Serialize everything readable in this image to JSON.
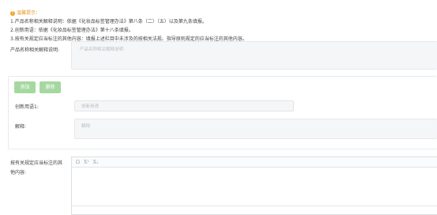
{
  "tips": {
    "title": "温馨提示：",
    "lines": [
      "1.产品名称相关解释说明：依据《化妆品标签管理办法》第八条（二）（五）以及第九条填报。",
      "2.创新用语：依据《化妆品标签管理办法》第十八条填报。",
      "3.按有关规定应当标注的其他内容：填报上述栏目中未涉及的按相关法规、指导原则规定的应当标注的其他内容。"
    ]
  },
  "product_explanation": {
    "label": "产品名称相关解释说明:",
    "placeholder": "产品名称相关解释说明"
  },
  "innovation": {
    "add_label": "添加",
    "delete_label": "删除",
    "term_label": "创新用语1:",
    "term_placeholder": "创新用语",
    "explain_label": "解释:",
    "explain_placeholder": "解释"
  },
  "other_content": {
    "label_line1": "按有关规定应当标注的其",
    "label_line2": "他内容:",
    "toolbar": [
      "Ω",
      "X²",
      "X₂"
    ]
  }
}
